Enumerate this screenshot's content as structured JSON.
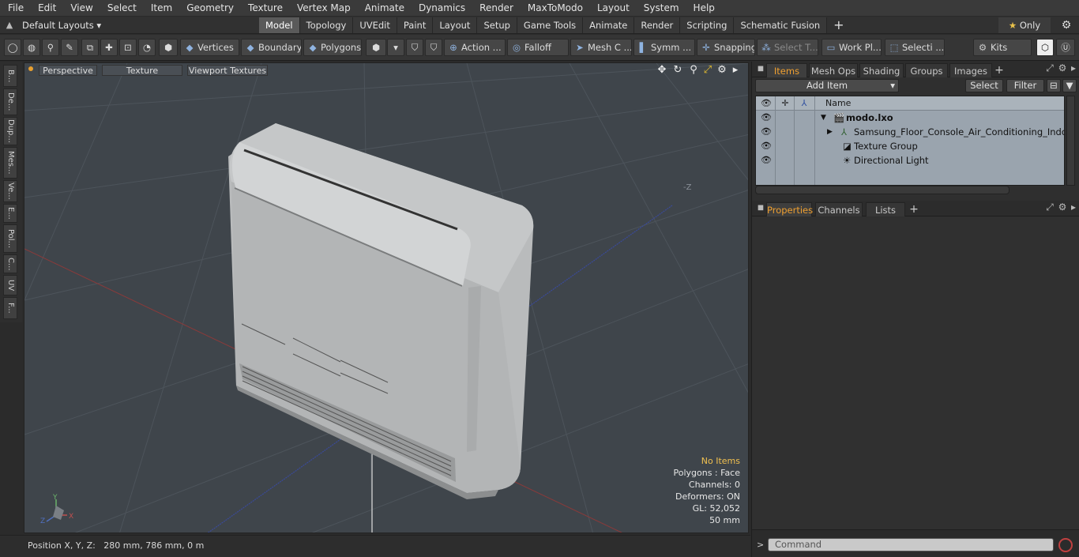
{
  "menu": [
    "File",
    "Edit",
    "View",
    "Select",
    "Item",
    "Geometry",
    "Texture",
    "Vertex Map",
    "Animate",
    "Dynamics",
    "Render",
    "MaxToModo",
    "Layout",
    "System",
    "Help"
  ],
  "layout": {
    "selector": "Default Layouts ▾"
  },
  "tabs": [
    "Model",
    "Topology",
    "UVEdit",
    "Paint",
    "Layout",
    "Setup",
    "Game Tools",
    "Animate",
    "Render",
    "Scripting",
    "Schematic Fusion"
  ],
  "only_label": "Only",
  "toolbar": {
    "vertices": "Vertices",
    "boundary": "Boundary",
    "polygons": "Polygons",
    "action": "Action",
    "falloff": "Falloff",
    "mesh": "Mesh C ...",
    "symmetry": "Symm ...",
    "snapping": "Snapping",
    "select_t": "Select T...",
    "work_plane": "Work Pl...",
    "selection": "Selecti ...",
    "kits": "Kits"
  },
  "left_tabs": [
    "B...",
    "De...",
    "Dup...",
    "Mes...",
    "Ve...",
    "E...",
    "Pol...",
    "C...",
    "UV",
    "F..."
  ],
  "viewport": {
    "tabs": [
      "Perspective",
      "Texture",
      "Viewport Textures"
    ],
    "axis_label": "-Z",
    "info": {
      "items": "No Items",
      "polygons": "Polygons : Face",
      "channels": "Channels: 0",
      "deformers": "Deformers: ON",
      "gl": "GL: 52,052",
      "scale": "50 mm"
    }
  },
  "status": {
    "position": "Position X, Y, Z:   280 mm, 786 mm, 0 m"
  },
  "items_panel": {
    "tabs": [
      "Items",
      "Mesh Ops",
      "Shading",
      "Groups",
      "Images"
    ],
    "add_item": "Add Item",
    "select": "Select",
    "filter": "Filter",
    "col_name": "Name",
    "rows": [
      {
        "label": "modo.lxo",
        "bold": true
      },
      {
        "label": "Samsung_Floor_Console_Air_Conditioning_Indoor_ ..."
      },
      {
        "label": "Texture Group"
      },
      {
        "label": "Directional Light"
      }
    ]
  },
  "props_panel": {
    "tabs": [
      "Properties",
      "Channels",
      "Lists"
    ]
  },
  "command": {
    "placeholder": "Command"
  },
  "colors": {
    "accent": "#f0a030",
    "viewport_bg": "#3f454b",
    "tree_bg": "#9aa4ae"
  }
}
